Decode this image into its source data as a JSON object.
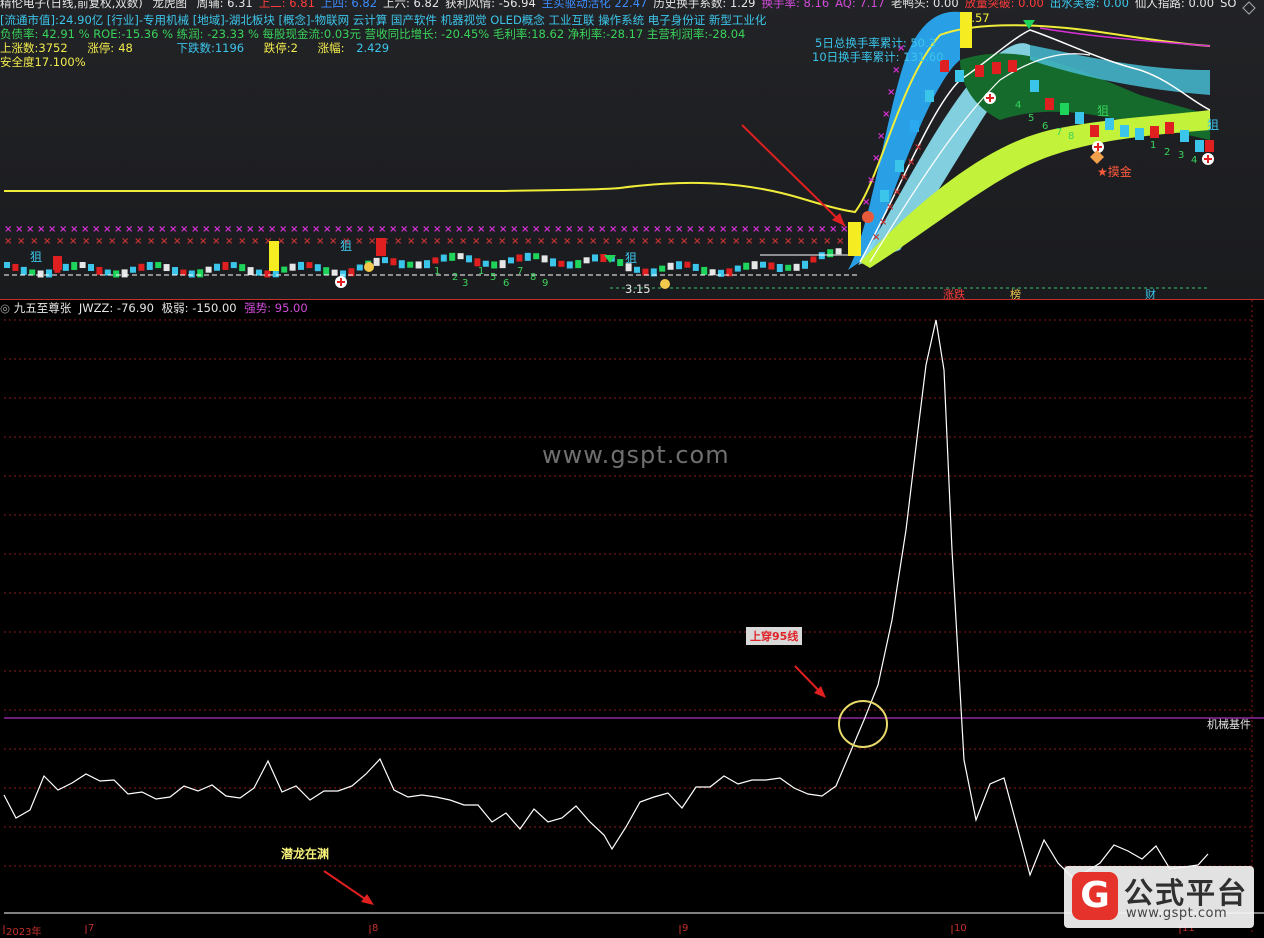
{
  "header": {
    "stock_name": "精伦电子(日线,前复权,双数)",
    "indicator_name": "龙虎图",
    "fields_row1": [
      {
        "label": "周辅:",
        "value": "6.31",
        "color": "#e6e6e6"
      },
      {
        "label": "上二:",
        "value": "6.81",
        "color": "#ff3b3b"
      },
      {
        "label": "上四:",
        "value": "6.82",
        "color": "#3c8cff"
      },
      {
        "label": "上六:",
        "value": "6.82",
        "color": "#e6e6e6"
      },
      {
        "label": "获利风情:",
        "value": "-56.94",
        "color": "#e6e6e6"
      },
      {
        "label": "主买驱动活化",
        "value": "22.47",
        "color": "#3c8cff"
      },
      {
        "label": "历史换手系数:",
        "value": "1.29",
        "color": "#e6e6e6"
      },
      {
        "label": "换手率:",
        "value": "8.16",
        "color": "#d04cd8"
      },
      {
        "label": "AQ:",
        "value": "7.17",
        "color": "#d04cd8"
      },
      {
        "label": "老鸭头:",
        "value": "0.00",
        "color": "#e6e6e6"
      },
      {
        "label": "放量突破:",
        "value": "0.00",
        "color": "#ff3b3b"
      },
      {
        "label": "出水芙蓉:",
        "value": "0.00",
        "color": "#3cc5ea"
      },
      {
        "label": "仙人指路:",
        "value": "0.00",
        "color": "#e6e6e6"
      },
      {
        "label": "SO",
        "value": "",
        "color": "#e6e6e6"
      }
    ],
    "row2": "[流通市值]:24.90亿 [行业]-专用机械 [地域]-湖北板块 [概念]-物联网 云计算 国产软件 机器视觉 OLED概念 工业互联 操作系统 电子身份证 新型工业化",
    "row3": "负债率: 42.91 % ROE:-15.36 % 练润: -23.33 % 每股现金流:0.03元 营收同比增长: -20.45% 毛利率:18.62 净利率:-28.17 主营利润率:-28.04",
    "row4": [
      {
        "label": "上涨数:",
        "value": "3752",
        "color": "#f2ec4e"
      },
      {
        "label": "涨停:",
        "value": "48",
        "color": "#f2ec4e"
      },
      {
        "label": "下跌数:",
        "value": "1196",
        "color": "#3cc5ea"
      },
      {
        "label": "跌停:",
        "value": "2",
        "color": "#f2ec4e"
      },
      {
        "label": "涨幅:",
        "value": "2.429",
        "color": "#3cc5ea"
      }
    ],
    "row5": "安全度17.100%"
  },
  "top_chart": {
    "turnover_5d": "5日总换手率累计: 50.3",
    "turnover_10d": "10日换手率累计: 131.60",
    "price_labels": {
      "high": "7.57",
      "low": "3.15"
    },
    "markers": [
      "狙",
      "狙",
      "狙",
      "狙",
      "狙"
    ],
    "moji": "★摸金",
    "bottom_tags": [
      "涨跌",
      "榜",
      "财"
    ],
    "counts_left": [
      "1",
      "2",
      "3",
      "1",
      "5",
      "6",
      "7",
      "8",
      "9"
    ],
    "counts_right": [
      "4",
      "5",
      "6",
      "7",
      "8",
      "1",
      "2",
      "3",
      "4"
    ],
    "colors": {
      "yellow_line": "#f0ec3a",
      "blue_band": "#2aa8f0",
      "cyan_band": "#8de2f4",
      "green_band": "#c3f23a",
      "dark_green": "#146b2c",
      "magenta_x": "#d631d6",
      "red_x": "#c23232"
    }
  },
  "indicator": {
    "title": "九五至尊张",
    "jwzz_label": "JWZZ:",
    "jwzz_value": "-76.90",
    "weak_label": "极弱:",
    "weak_value": "-150.00",
    "strong_label": "强势:",
    "strong_value": "95.00",
    "line_label": "机械基件",
    "annotation_cross": "上穿95线",
    "annotation_dragon": "潜龙在渊",
    "watermark": "www.gspt.com",
    "x_axis": [
      "2023年",
      "7",
      "8",
      "9",
      "10",
      "11"
    ],
    "colors": {
      "line": "#ffffff",
      "level95": "#b030c0",
      "grid": "#8b1a1a",
      "circle": "#e8d86a",
      "arrow": "#e02020"
    }
  },
  "logo": {
    "mark": "G",
    "title": "公式平台",
    "url": "www.gspt.com"
  }
}
